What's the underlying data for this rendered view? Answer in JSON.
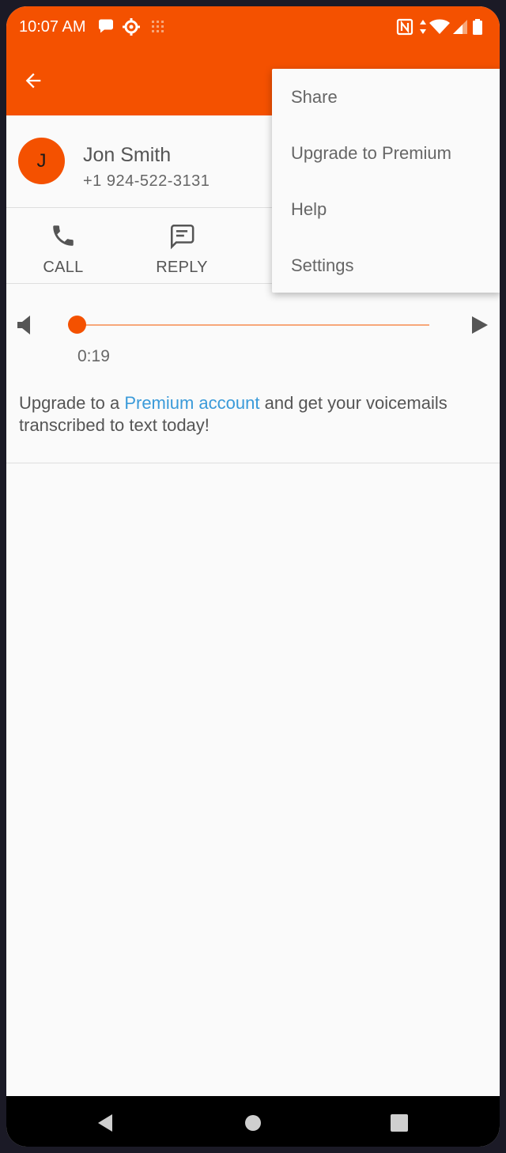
{
  "status_bar": {
    "time": "10:07 AM",
    "icons": [
      "chat-bubble-icon",
      "settings-cog-icon",
      "grid-dots-icon",
      "nfc-icon",
      "data-arrows-icon",
      "wifi-icon",
      "signal-icon",
      "battery-icon"
    ]
  },
  "app_bar": {
    "back_icon": "arrow-back-icon"
  },
  "contact": {
    "initial": "J",
    "name": "Jon Smith",
    "phone": "+1 924-522-3131"
  },
  "actions": [
    {
      "label": "CALL",
      "icon": "phone-icon"
    },
    {
      "label": "REPLY",
      "icon": "message-icon"
    }
  ],
  "player": {
    "elapsed": "0:19",
    "progress": 0
  },
  "promo": {
    "before": "Upgrade to a ",
    "link": "Premium account",
    "after": " and get your voicemails transcribed to text today!"
  },
  "menu": {
    "items": [
      "Share",
      "Upgrade to Premium",
      "Help",
      "Settings"
    ]
  },
  "colors": {
    "accent": "#f45100",
    "link": "#3a9ad9"
  }
}
